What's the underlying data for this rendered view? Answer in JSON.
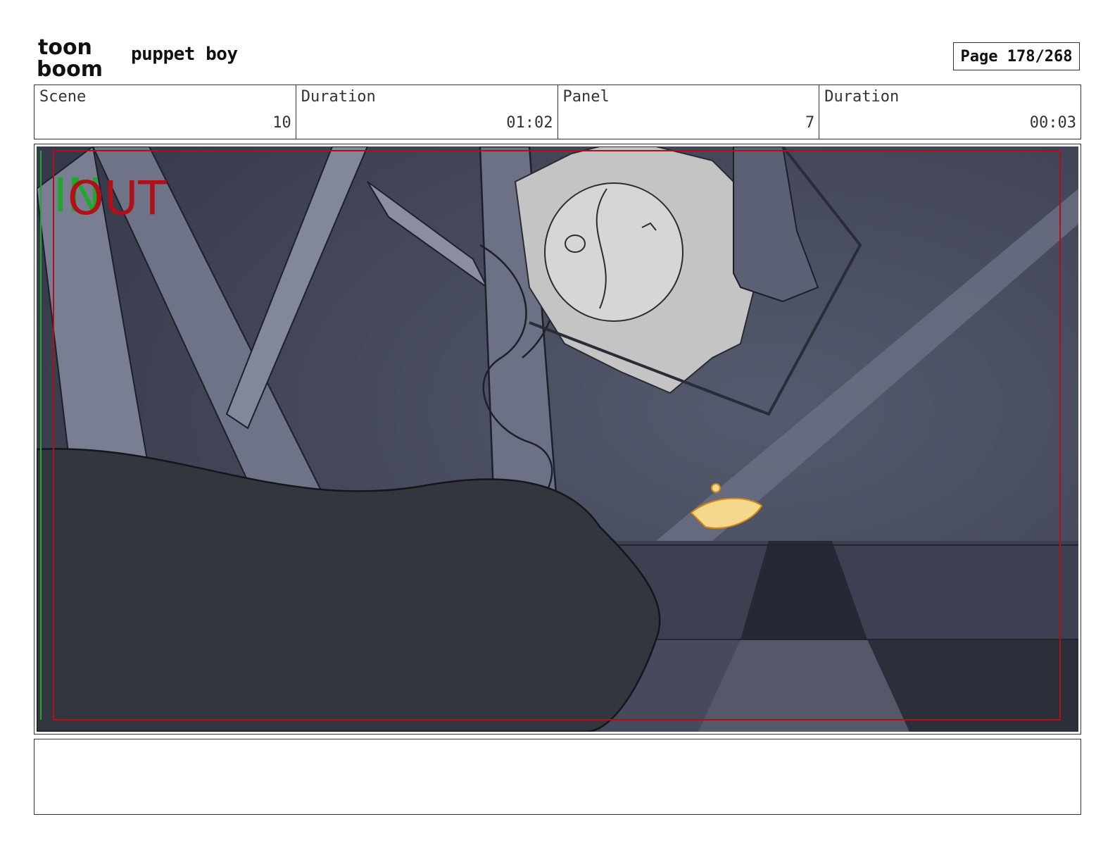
{
  "header": {
    "logo_line1": "toon",
    "logo_line2": "boom",
    "project_title": "puppet boy",
    "page_label": "Page 178/268"
  },
  "info": {
    "scene_label": "Scene",
    "scene_value": "10",
    "scene_duration_label": "Duration",
    "scene_duration_value": "01:02",
    "panel_label": "Panel",
    "panel_value": "7",
    "panel_duration_label": "Duration",
    "panel_duration_value": "00:03"
  },
  "panel": {
    "in_marker": "IN",
    "out_marker": "OUT",
    "in_color": "#1fa82a",
    "out_color": "#b0101a",
    "safe_frame_color": "#b0101a"
  },
  "notes": {
    "text": ""
  }
}
